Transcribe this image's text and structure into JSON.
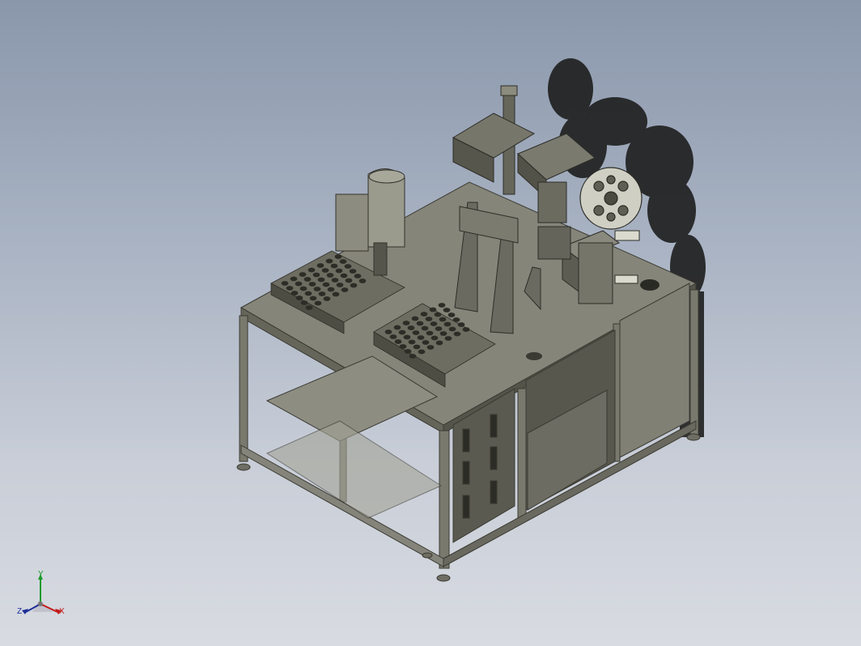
{
  "view": {
    "background_top": "#8a97ab",
    "background_bottom": "#d8dbe1",
    "model_color": "#7b7a69",
    "model_dark": "#4a4a40",
    "shadow_color": "#222222"
  },
  "triad": {
    "x_label": "X",
    "y_label": "Y",
    "z_label": "Z",
    "x_color": "#c21a1a",
    "y_color": "#1a9a2a",
    "z_color": "#1f2f99"
  }
}
